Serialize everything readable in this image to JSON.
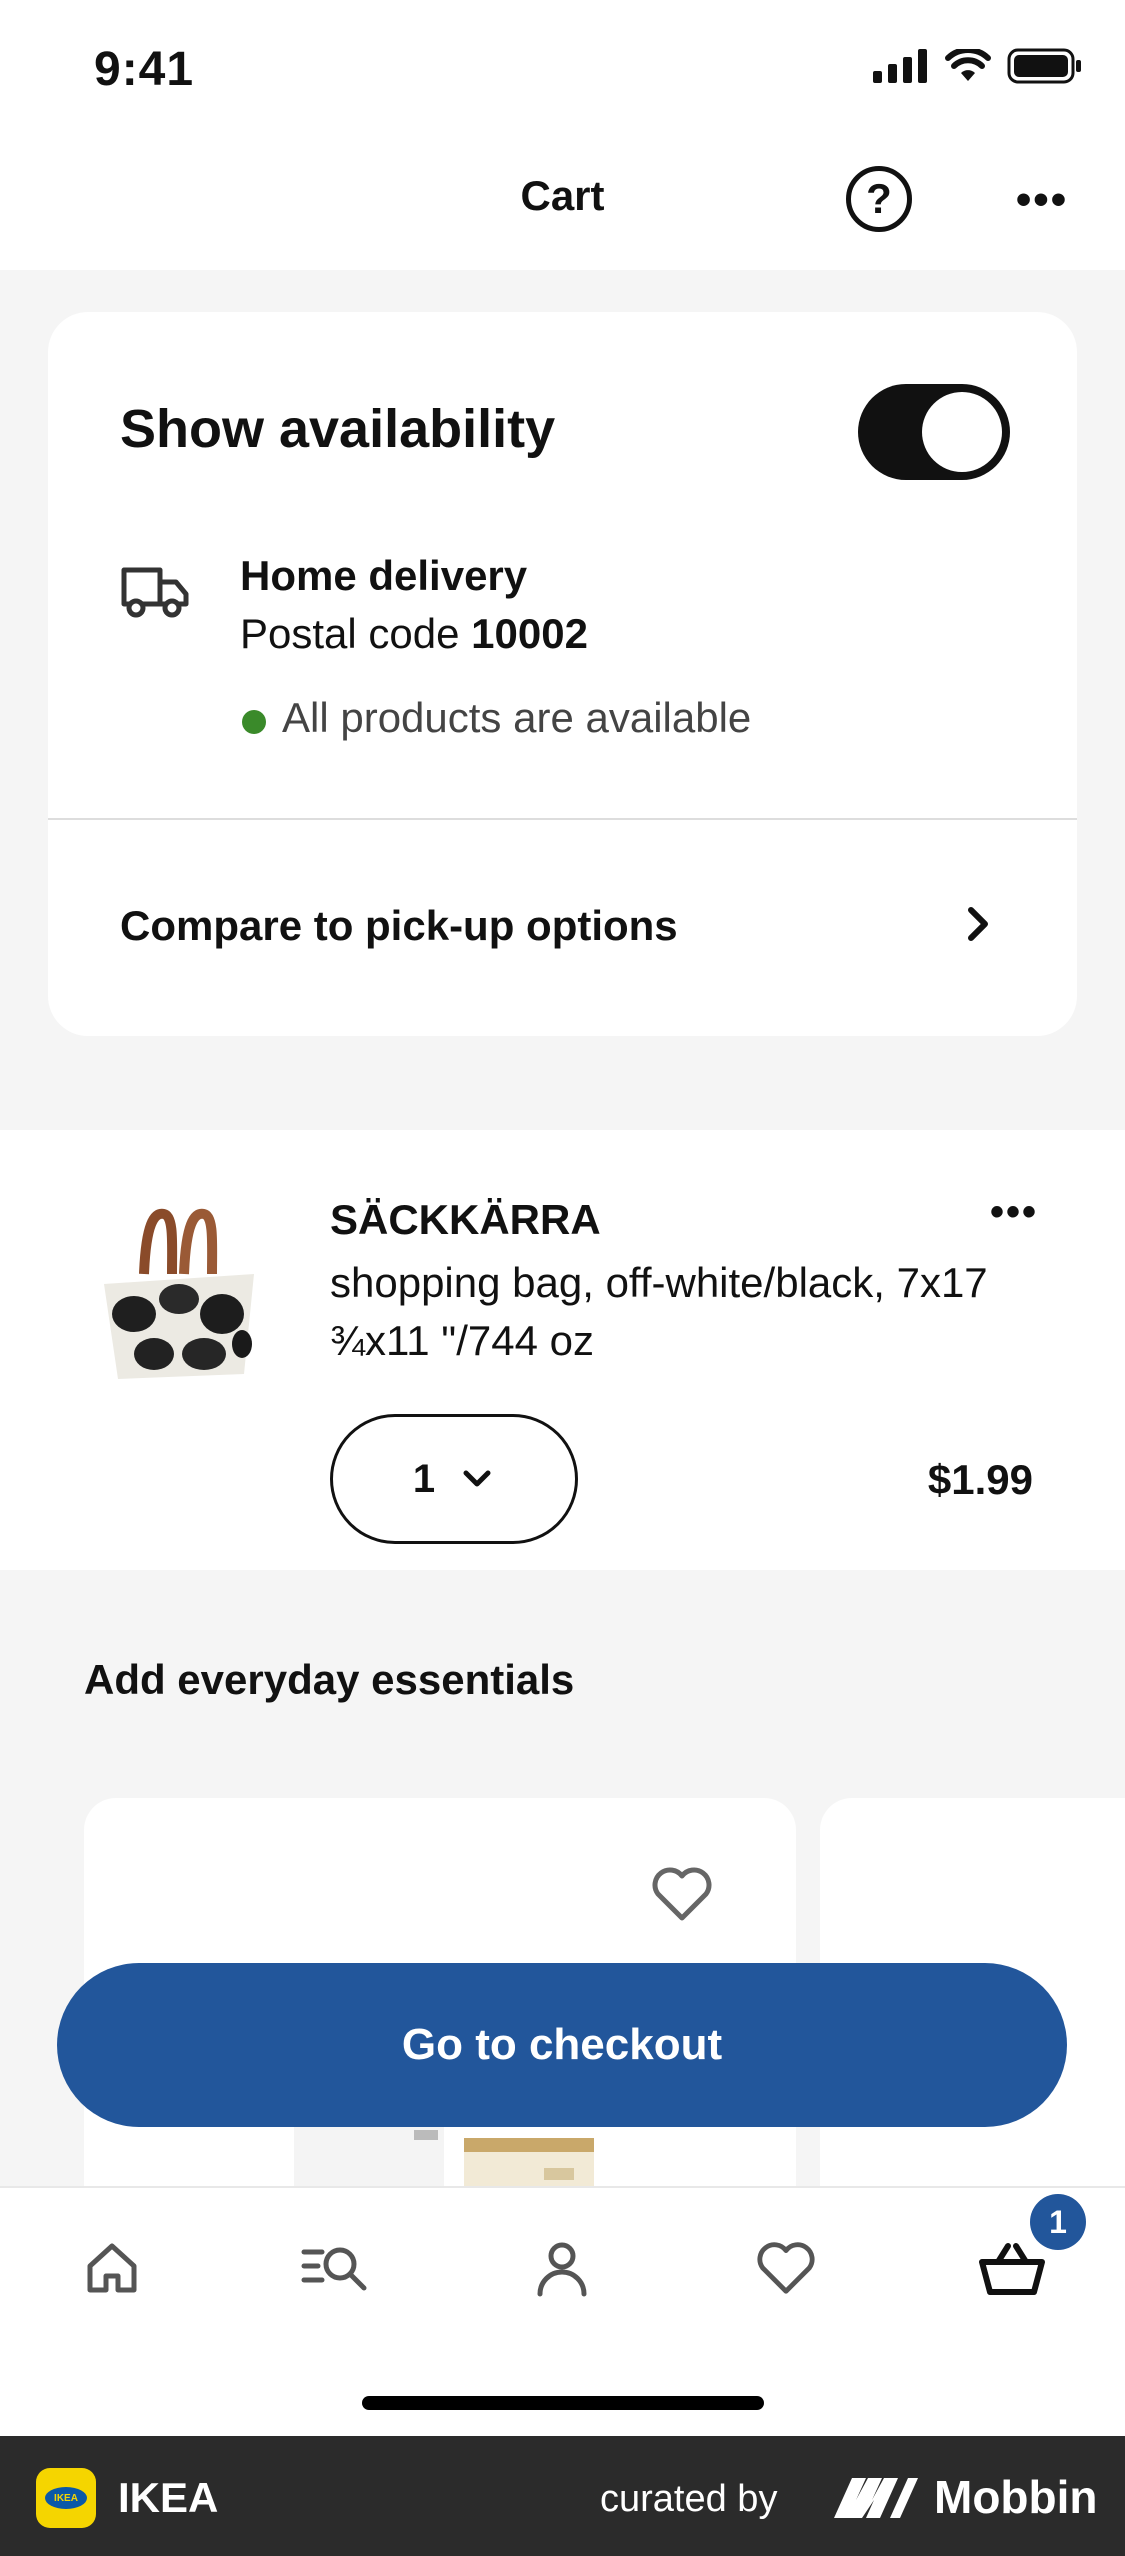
{
  "status_bar": {
    "time": "9:41"
  },
  "header": {
    "title": "Cart",
    "help_label": "?",
    "more_label": "•••"
  },
  "availability": {
    "title": "Show availability",
    "toggle_on": true,
    "delivery_title": "Home delivery",
    "postal_prefix": "Postal code",
    "postal_code": "10002",
    "status_message": "All products are available",
    "status_color": "#3a8a2a",
    "compare_label": "Compare to pick-up options"
  },
  "product": {
    "name": "SÄCKKÄRRA",
    "description": "shopping bag, off-white/black, 7x17 ¾x11 \"/744 oz",
    "quantity": "1",
    "price": "$1.99",
    "more_label": "•••"
  },
  "essentials": {
    "title": "Add everyday essentials"
  },
  "checkout": {
    "label": "Go to checkout",
    "color": "#22569b"
  },
  "tabbar": {
    "items": [
      {
        "name": "home",
        "icon": "home-icon"
      },
      {
        "name": "search",
        "icon": "search-icon"
      },
      {
        "name": "profile",
        "icon": "profile-icon"
      },
      {
        "name": "favourites",
        "icon": "heart-icon"
      },
      {
        "name": "cart",
        "icon": "basket-icon"
      }
    ],
    "cart_badge": "1"
  },
  "footer": {
    "app_name": "IKEA",
    "logo_text": "IKEA",
    "curated_by": "curated by",
    "mobbin": "Mobbin"
  }
}
